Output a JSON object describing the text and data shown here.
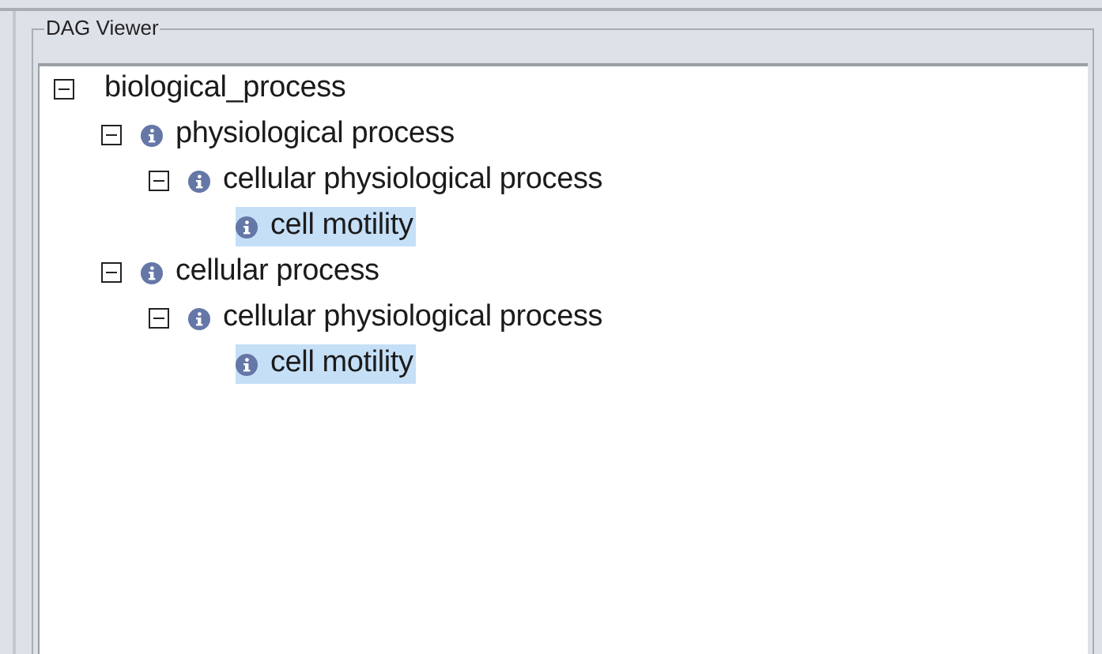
{
  "panel": {
    "title": "DAG Viewer"
  },
  "tree": [
    {
      "label": "biological_process",
      "info": false,
      "expanded": true,
      "selected": false,
      "children": [
        {
          "label": "physiological process",
          "info": true,
          "expanded": true,
          "selected": false,
          "children": [
            {
              "label": "cellular physiological process",
              "info": true,
              "expanded": true,
              "selected": false,
              "children": [
                {
                  "label": "cell motility",
                  "info": true,
                  "selected": true
                }
              ]
            }
          ]
        },
        {
          "label": "cellular process",
          "info": true,
          "expanded": true,
          "selected": false,
          "children": [
            {
              "label": "cellular physiological process",
              "info": true,
              "expanded": true,
              "selected": false,
              "children": [
                {
                  "label": "cell motility",
                  "info": true,
                  "selected": true
                }
              ]
            }
          ]
        }
      ]
    }
  ]
}
